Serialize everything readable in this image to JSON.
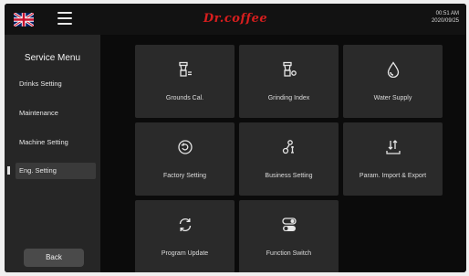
{
  "header": {
    "brand": "Dr.coffee",
    "time": "00:51 AM",
    "date": "2020/09/25"
  },
  "sidebar": {
    "title": "Service Menu",
    "items": [
      {
        "label": "Drinks Setting"
      },
      {
        "label": "Maintenance"
      },
      {
        "label": "Machine Setting"
      },
      {
        "label": "Eng. Setting"
      }
    ],
    "back_label": "Back"
  },
  "tiles": [
    {
      "label": "Grounds Cal.",
      "icon": "grinder-icon"
    },
    {
      "label": "Grinding Index",
      "icon": "grinder-gear-icon"
    },
    {
      "label": "Water Supply",
      "icon": "water-drop-icon"
    },
    {
      "label": "Factory Setting",
      "icon": "factory-reset-icon"
    },
    {
      "label": "Business Setting",
      "icon": "business-icon"
    },
    {
      "label": "Param. Import & Export",
      "icon": "import-export-icon"
    },
    {
      "label": "Program Update",
      "icon": "refresh-icon"
    },
    {
      "label": "Function Switch",
      "icon": "toggle-switch-icon"
    }
  ],
  "colors": {
    "brand": "#d71e1e",
    "background": "#0b0b0b",
    "sidebar": "#262626",
    "tile": "#2a2a2a"
  }
}
